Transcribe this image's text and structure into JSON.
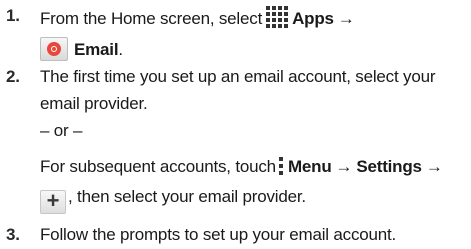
{
  "steps": [
    {
      "number": "1.",
      "text_a": "From the Home screen, select",
      "apps_label": "Apps",
      "arrow": "→",
      "email_label": "Email",
      "period": "."
    },
    {
      "number": "2.",
      "line1": "The first time you set up an email account, select your",
      "line2": "email provider.",
      "or": "– or –",
      "line4_a": "For subsequent accounts, touch",
      "menu_label": "Menu",
      "arrow": "→",
      "settings_label": "Settings",
      "arrow2": "→",
      "line5_b": ", then select your email provider."
    },
    {
      "number": "3.",
      "text": "Follow the prompts to set up your email account."
    }
  ],
  "icons": {
    "apps": "apps-grid-icon",
    "email": "email-icon",
    "menu": "menu-icon",
    "plus": "plus-icon"
  },
  "colors": {
    "email_icon_red": "#e8473b",
    "text": "#1a1a1a"
  }
}
